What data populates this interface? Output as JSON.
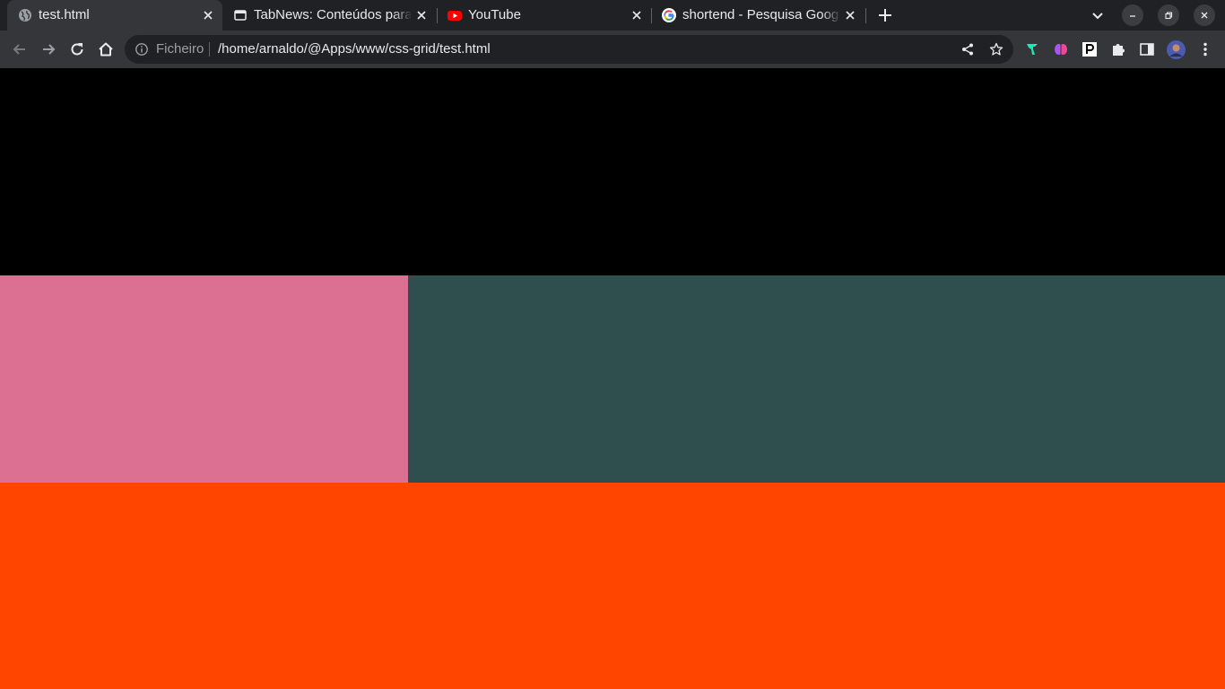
{
  "tabs": [
    {
      "title": "test.html",
      "icon": "globe-icon",
      "active": true
    },
    {
      "title": "TabNews: Conteúdos para",
      "icon": "window-icon",
      "active": false
    },
    {
      "title": "YouTube",
      "icon": "youtube-icon",
      "active": false
    },
    {
      "title": "shortend - Pesquisa Goog",
      "icon": "google-icon",
      "active": false
    }
  ],
  "toolbar": {
    "scheme_label": "Ficheiro",
    "url": "/home/arnaldo/@Apps/www/css-grid/test.html"
  },
  "page": {
    "colors": {
      "header": "#000000",
      "sidebar": "#db7093",
      "main": "#2f4f4f",
      "footer": "#ff4500"
    }
  }
}
